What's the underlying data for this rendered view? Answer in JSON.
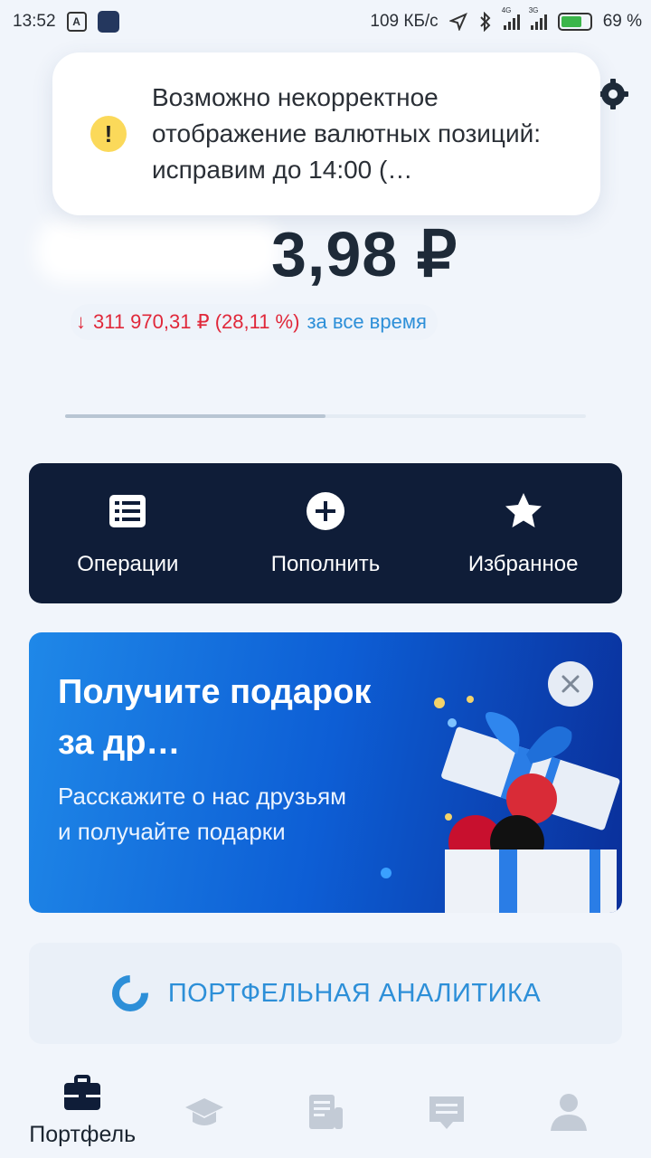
{
  "status_bar": {
    "time": "13:52",
    "network_speed": "109 КБ/с",
    "signal1_label": "4G",
    "signal2_label": "3G",
    "battery": "69 %"
  },
  "notice": {
    "icon": "exclamation-icon",
    "text": "Возможно некорректное отображение валютных позиций: исправим до 14:00 (…"
  },
  "portfolio": {
    "balance_visible": "3,98 ₽",
    "change_amount": "311 970,31 ₽ (28,11 %)",
    "change_period": "за все время",
    "change_direction": "down",
    "carousel_progress": 0.5
  },
  "actions": [
    {
      "label": "Операции",
      "icon": "list-icon"
    },
    {
      "label": "Пополнить",
      "icon": "plus-circle-icon"
    },
    {
      "label": "Избранное",
      "icon": "star-icon"
    }
  ],
  "promo": {
    "title": "Получите подарок за др…",
    "text": "Расскажите о нас друзьям и получайте подарки"
  },
  "analytics": {
    "label": "ПОРТФЕЛЬНАЯ АНАЛИТИКА"
  },
  "bottom_nav": [
    {
      "label": "Портфель",
      "icon": "briefcase-icon",
      "active": true
    },
    {
      "label": "",
      "icon": "graduation-cap-icon",
      "active": false
    },
    {
      "label": "",
      "icon": "news-icon",
      "active": false
    },
    {
      "label": "",
      "icon": "chat-icon",
      "active": false
    },
    {
      "label": "",
      "icon": "profile-icon",
      "active": false
    }
  ],
  "colors": {
    "accent_blue": "#2d8fd8",
    "negative_red": "#e0283a",
    "action_bar_bg": "#0f1d38",
    "warning_yellow": "#fbd95a"
  }
}
